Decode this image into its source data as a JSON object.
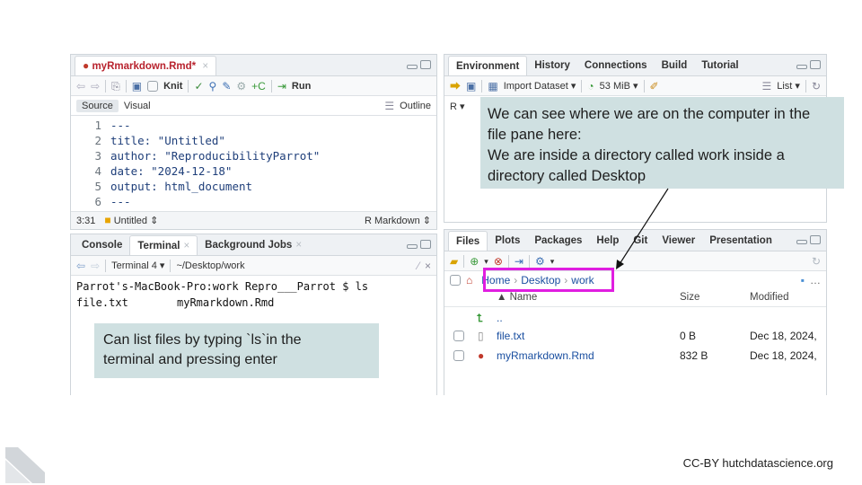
{
  "editor": {
    "tab_title": "myRmarkdown.Rmd*",
    "knit_label": "Knit",
    "run_label": "Run",
    "source_tab": "Source",
    "visual_tab": "Visual",
    "outline_label": "Outline",
    "lines": [
      {
        "num": "1",
        "text": "---"
      },
      {
        "num": "2",
        "text": "title: \"Untitled\""
      },
      {
        "num": "3",
        "text": "author: \"ReproducibilityParrot\""
      },
      {
        "num": "4",
        "text": "date: \"2024-12-18\""
      },
      {
        "num": "5",
        "text": "output: html_document"
      },
      {
        "num": "6",
        "text": "---"
      }
    ],
    "cursor_pos": "3:31",
    "chunk_label": "Untitled",
    "mode_label": "R Markdown"
  },
  "console": {
    "tabs": [
      "Console",
      "Terminal",
      "Background Jobs"
    ],
    "terminal_select": "Terminal 4",
    "path": "~/Desktop/work",
    "prompt_line": "Parrot's-MacBook-Pro:work Repro___Parrot $ ls",
    "output_file1": "file.txt",
    "output_file2": "myRmarkdown.Rmd"
  },
  "environment": {
    "tabs": [
      "Environment",
      "History",
      "Connections",
      "Build",
      "Tutorial"
    ],
    "import_label": "Import Dataset",
    "memory_label": "53 MiB",
    "list_label": "List",
    "r_label": "R"
  },
  "files": {
    "tabs": [
      "Files",
      "Plots",
      "Packages",
      "Help",
      "Git",
      "Viewer",
      "Presentation"
    ],
    "breadcrumb": [
      "Home",
      "Desktop",
      "work"
    ],
    "col_name": "Name",
    "col_size": "Size",
    "col_modified": "Modified",
    "up_label": "..",
    "rows": [
      {
        "name": "file.txt",
        "size": "0 B",
        "modified": "Dec 18, 2024,"
      },
      {
        "name": "myRmarkdown.Rmd",
        "size": "832 B",
        "modified": "Dec 18, 2024,"
      }
    ]
  },
  "callouts": {
    "top_right": [
      "We can see where we are on the computer in the",
      "file pane here:",
      "We are inside a directory called work inside a",
      "directory called Desktop"
    ],
    "bottom_left": [
      "Can list files by typing `ls`in the",
      "terminal and pressing enter"
    ]
  },
  "footer": "CC-BY  hutchdatascience.org",
  "colors": {
    "highlight_box": "#e01ee0",
    "callout_bg": "#cfe0e1",
    "link_blue": "#1a4fa0"
  }
}
